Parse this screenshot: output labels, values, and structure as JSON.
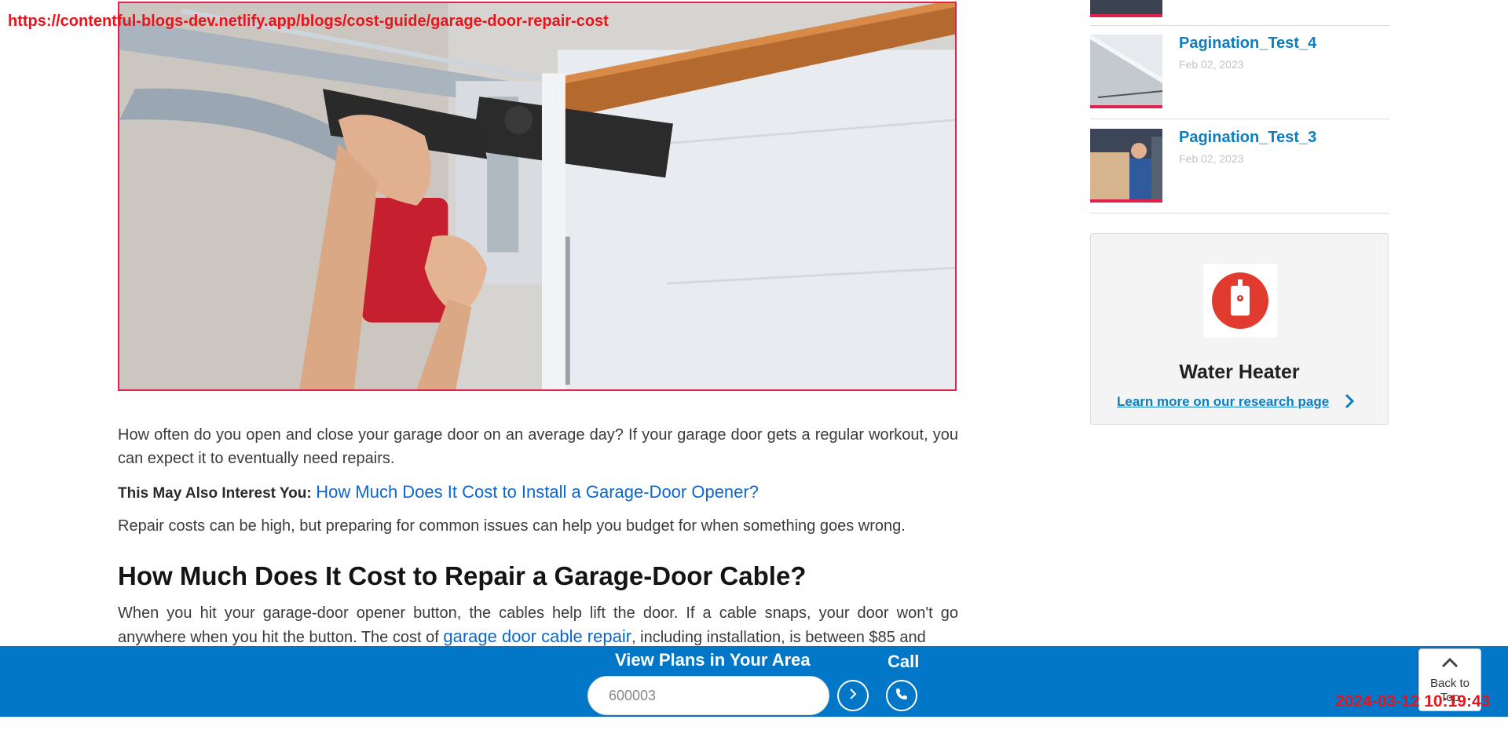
{
  "overlay": {
    "url": "https://contentful-blogs-dev.netlify.app/blogs/cost-guide/garage-door-repair-cost",
    "timestamp": "2024-03-12 10:19:43"
  },
  "article": {
    "intro": "How often do you open and close your garage door on an average day? If your garage door gets a regular workout, you can expect it to eventually need repairs.",
    "interest_label": "This May Also Interest You:",
    "interest_link": "How Much Does It Cost to Install a Garage-Door Opener?",
    "para2": "Repair costs can be high, but preparing for common issues can help you budget for when something goes wrong.",
    "heading": "How Much Does It Cost to Repair a Garage-Door Cable?",
    "para3_before": "When you hit your garage-door opener button, the cables help lift the door. If a cable snaps, your door won't go anywhere when you hit the button. The cost of ",
    "para3_link": "garage door cable repair",
    "para3_after": ", including installation, is between $85 and"
  },
  "sidebar": {
    "posts": [
      {
        "title": "Pagination_Test_4",
        "date": "Feb 02, 2023"
      },
      {
        "title": "Pagination_Test_3",
        "date": "Feb 02, 2023"
      }
    ],
    "card": {
      "title": "Water Heater",
      "link": "Learn more on our research page",
      "icon": "water-heater-icon"
    }
  },
  "bottom_bar": {
    "title": "View Plans in Your Area",
    "zip_placeholder": "600003",
    "call_label": "Call",
    "back_to_top": "Back to Top"
  },
  "colors": {
    "brand_blue": "#0277c8",
    "link_blue": "#0a66d0",
    "sidebar_blue": "#0b7ec2",
    "accent_red": "#e0214d"
  }
}
